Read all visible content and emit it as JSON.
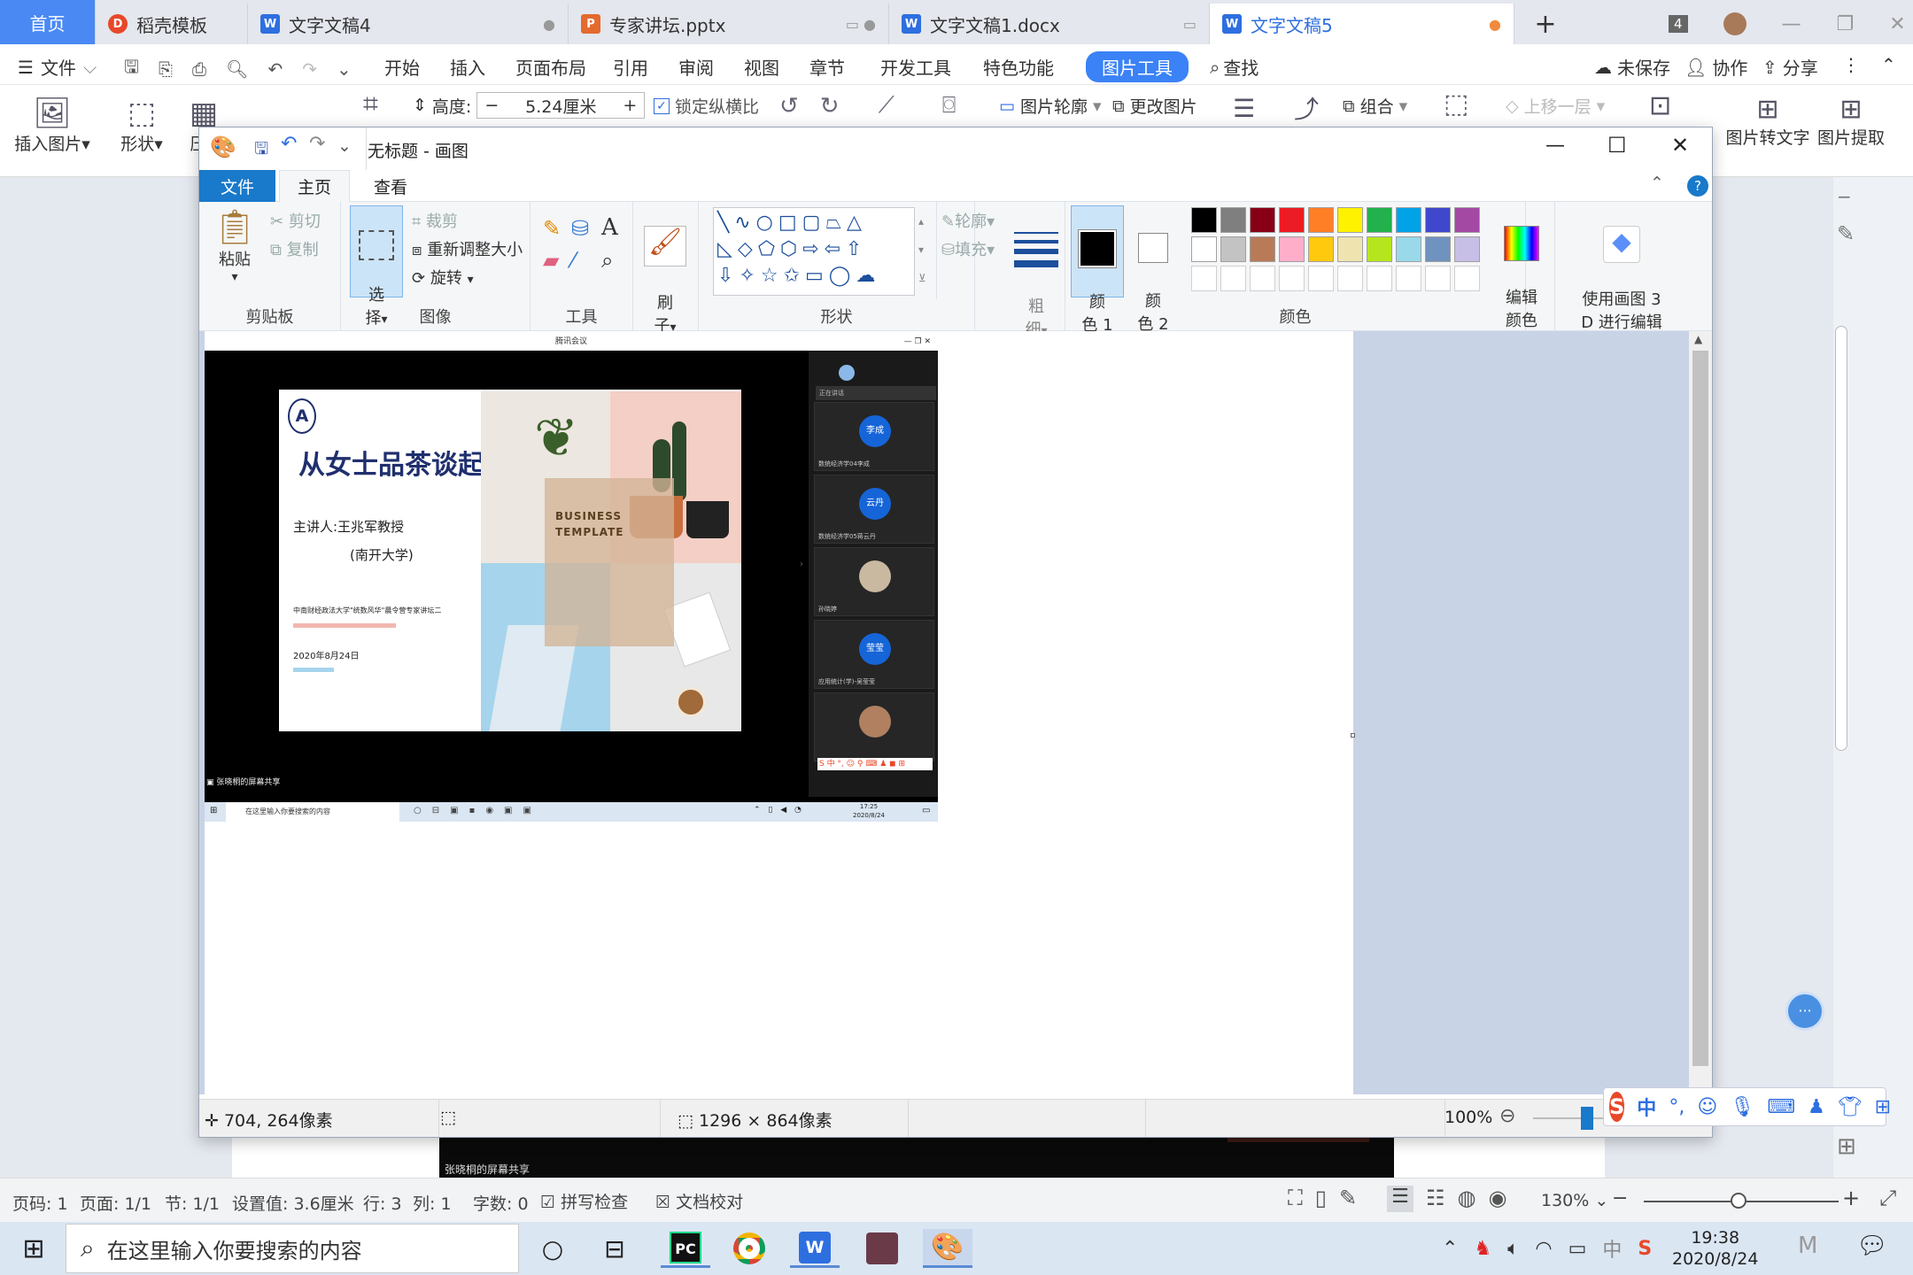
{
  "wps_tabs": [
    {
      "label": "首页",
      "kind": "home"
    },
    {
      "label": "稻壳模板",
      "icon": "docer-icon"
    },
    {
      "label": "文字文稿4",
      "icon": "wps-writer-icon",
      "has_close": true
    },
    {
      "label": "专家讲坛.pptx",
      "icon": "wps-presentation-icon",
      "has_close": true
    },
    {
      "label": "文字文稿1.docx",
      "icon": "wps-writer-icon",
      "has_close": true
    },
    {
      "label": "文字文稿5",
      "icon": "wps-writer-icon",
      "active": true
    }
  ],
  "wps_window": {
    "window_count": "4"
  },
  "wps_menu": {
    "file": "文件",
    "items": [
      "开始",
      "插入",
      "页面布局",
      "引用",
      "审阅",
      "视图",
      "章节",
      "开发工具",
      "特色功能"
    ],
    "active": "图片工具",
    "search": "查找",
    "unsaved": "未保存",
    "collab": "协作",
    "share": "分享"
  },
  "wps_ribbon": {
    "insert_picture": "插入图片",
    "shape": "形状",
    "compress": "压",
    "height_label": "高度:",
    "height_value": "5.24厘米",
    "lock_ratio": "锁定纵横比",
    "outline": "图片轮廓",
    "change": "更改图片",
    "group": "组合",
    "move_up": "上移一层",
    "to_text": "图片转文字",
    "extract": "图片提取"
  },
  "paint": {
    "title": "无标题 - 画图",
    "tabs": [
      "文件",
      "主页",
      "查看"
    ],
    "clipboard": {
      "label": "剪贴板",
      "paste": "粘贴",
      "cut": "剪切",
      "copy": "复制"
    },
    "image": {
      "label": "图像",
      "select": "选\n择",
      "crop": "裁剪",
      "resize": "重新调整大小",
      "rotate": "旋转"
    },
    "tools": {
      "label": "工具"
    },
    "brush": "刷\n子",
    "shapes": {
      "label": "形状",
      "outline": "轮廓",
      "fill": "填充"
    },
    "size": "粗\n细",
    "color1": "颜\n色 1",
    "color2": "颜\n色 2",
    "colors_label": "颜色",
    "edit_colors": "编辑\n颜色",
    "paint3d": "使用画图 3\nD 进行编辑",
    "palette_row1": [
      "#000000",
      "#7f7f7f",
      "#880015",
      "#ed1c24",
      "#ff7f27",
      "#fff200",
      "#22b14c",
      "#00a2e8",
      "#3f48cc",
      "#a349a4"
    ],
    "palette_row2": [
      "#ffffff",
      "#c3c3c3",
      "#b97a57",
      "#ffaec9",
      "#ffc90e",
      "#efe4b0",
      "#b5e61d",
      "#99d9ea",
      "#7092be",
      "#c8bfe7"
    ],
    "status": {
      "cursor": "704, 264像素",
      "size": "1296 × 864像素",
      "zoom": "100%"
    }
  },
  "screenshot": {
    "meeting_title": "腾讯会议",
    "slide_title": "从女士品茶谈起",
    "speaker": "主讲人:王兆军教授",
    "affiliation": "(南开大学)",
    "series": "中南财经政法大学\"统数风华\"晨令营专家讲坛二",
    "date": "2020年8月24日",
    "template1": "BUSINESS",
    "template2": "TEMPLATE",
    "speaking": "正在讲话",
    "participants": [
      {
        "avatar": "李成",
        "name": "数统经济学04李成"
      },
      {
        "avatar": "云丹",
        "name": "数统经济学05蒋云丹"
      },
      {
        "avatar": "",
        "name": "孙晓婷"
      },
      {
        "avatar": "莹莹",
        "name": "应用统计(学)-吴莹莹"
      },
      {
        "avatar": "",
        "name": ""
      }
    ],
    "share_label": "张晓桐的屏幕共享",
    "search": "在这里输入你要搜索的内容",
    "time": "17:25",
    "date2": "2020/8/24"
  },
  "wps_status": {
    "page": "页码: 1",
    "pages": "页面: 1/1",
    "section": "节: 1/1",
    "setting": "设置值: 3.6厘米",
    "row": "行: 3",
    "col": "列: 1",
    "words": "字数: 0",
    "spell": "拼写检查",
    "proof": "文档校对",
    "zoom": "130%"
  },
  "doc_bottom_text": "张晓桐的屏幕共享",
  "taskbar": {
    "search": "在这里输入你要搜索的内容",
    "ime": "中",
    "time": "19:38",
    "date": "2020/8/24"
  }
}
